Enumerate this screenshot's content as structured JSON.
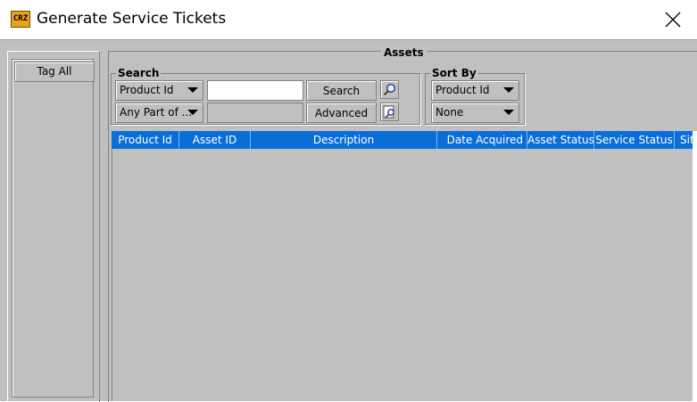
{
  "window": {
    "icon_text": "CRZ",
    "title": "Generate Service Tickets",
    "close_icon": "close-icon"
  },
  "left_panel": {
    "tag_all_label": "Tag All"
  },
  "assets": {
    "title": "Assets",
    "search": {
      "label": "Search",
      "field_select": "Product Id",
      "match_select": "Any Part of ...",
      "search_input_value": "",
      "search_button": "Search",
      "advanced_button": "Advanced",
      "search_icon": "magnifier-icon",
      "advanced_icon": "advanced-search-icon"
    },
    "sort_by": {
      "label": "Sort By",
      "field_select": "Product Id",
      "order_select": "None"
    },
    "table": {
      "columns": [
        "Product Id",
        "Asset ID",
        "Description",
        "Date Acquired",
        "Asset Status",
        "Service Status",
        "Sit"
      ],
      "rows": []
    }
  },
  "colors": {
    "window_bg": "#c0c0c0",
    "header_bg": "#0a6ed8",
    "header_text": "#ffffff"
  }
}
